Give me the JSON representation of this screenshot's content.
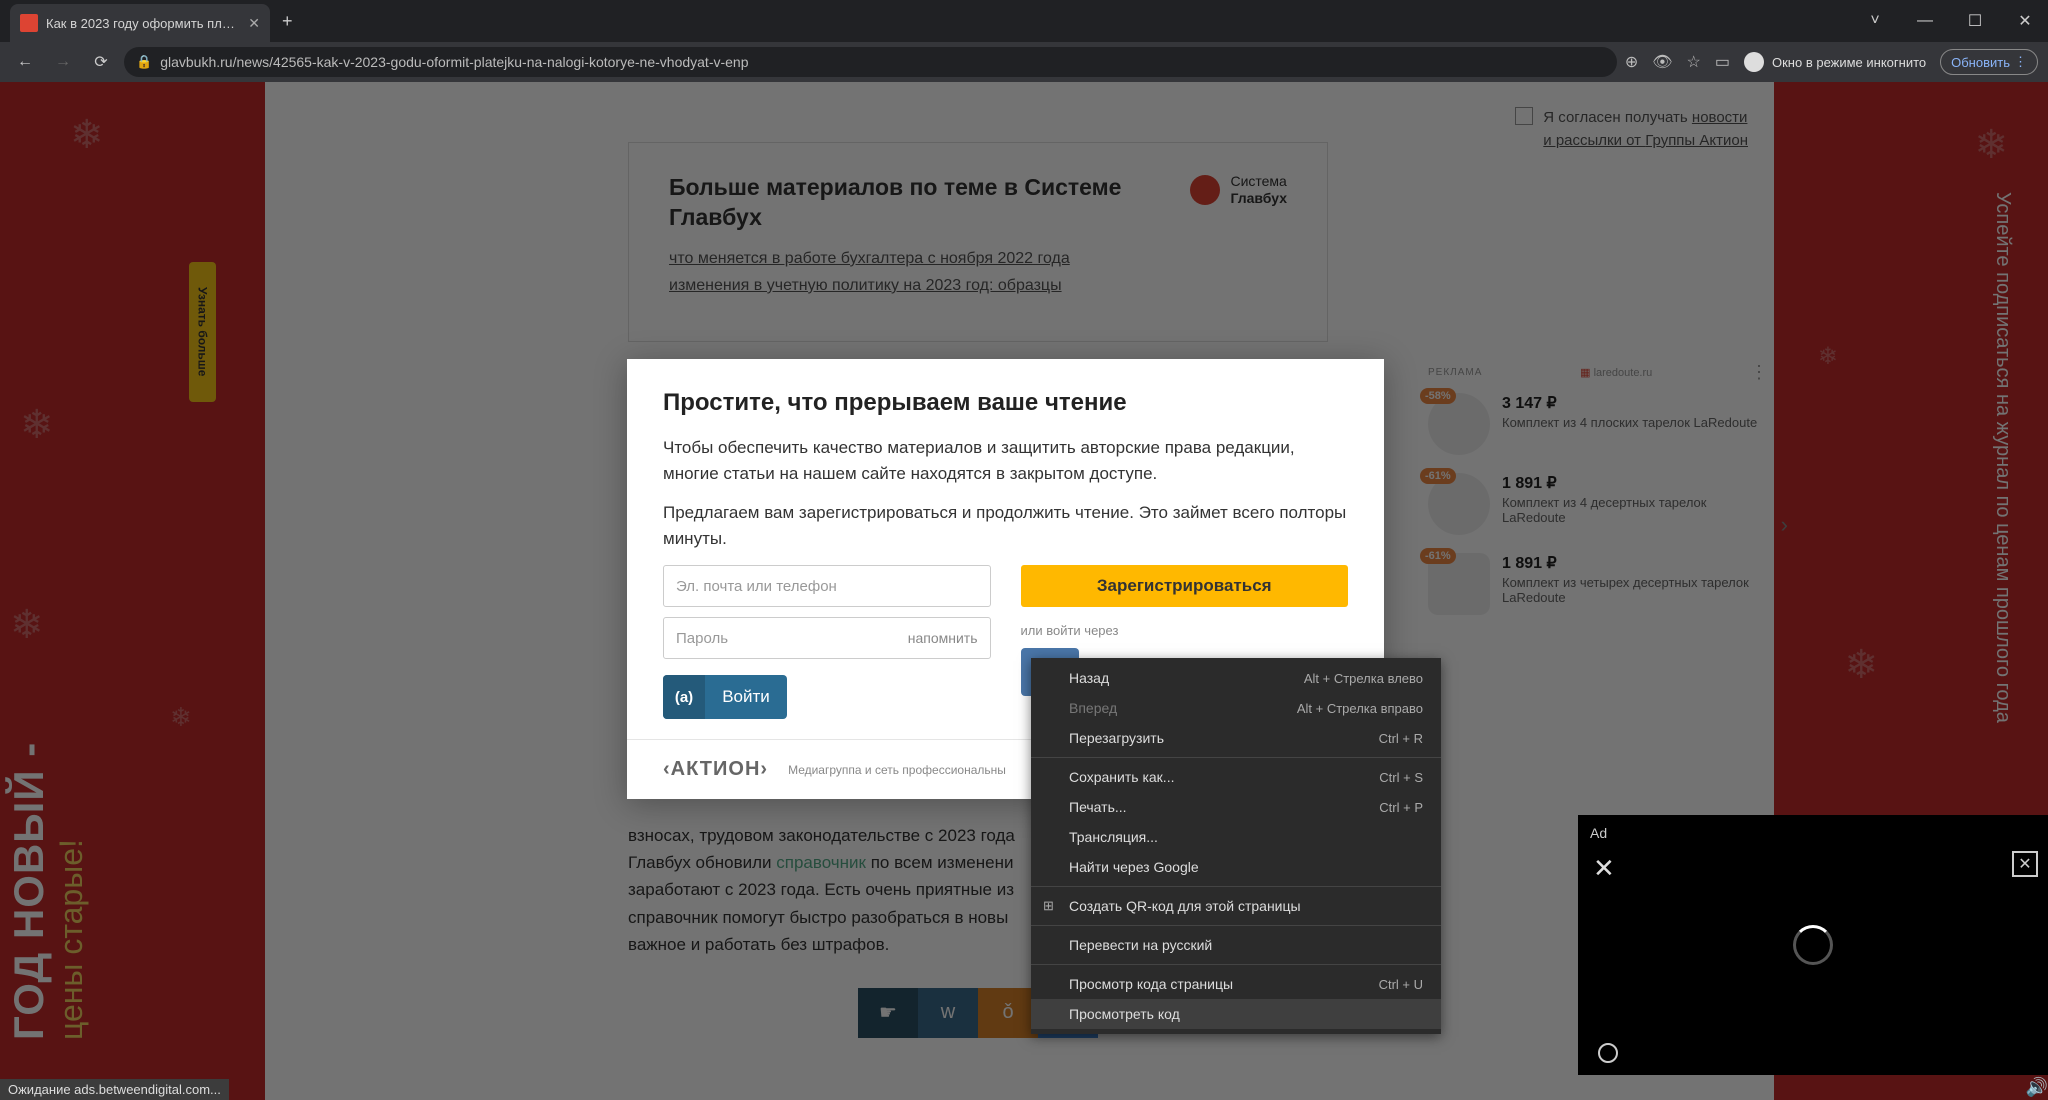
{
  "browser": {
    "tab_title": "Как в 2023 году оформить плат...",
    "url": "glavbukh.ru/news/42565-kak-v-2023-godu-oformit-platejku-na-nalogi-kotorye-ne-vhodyat-v-enp",
    "incognito_label": "Окно в режиме инкогнито",
    "update_button": "Обновить",
    "status": "Ожидание ads.betweendigital.com..."
  },
  "banners": {
    "left_line1": "ГОД НОВЫЙ -",
    "left_line2": "цены старые!",
    "left_sticker": "Узнать больше",
    "right_text": "Успейте подписаться на журнал по ценам прошлого года"
  },
  "consent": {
    "text_before": "Я согласен получать ",
    "link1": "новости",
    "text_mid": " и рассылки от ",
    "link2": "Группы Актион"
  },
  "related": {
    "title": "Больше материалов по теме в Системе Главбух",
    "brand_top": "Система",
    "brand_bottom": "Главбух",
    "link1": "что меняется в работе бухгалтера с ноября 2022 года",
    "link2": "изменения в учетную политику на 2023 год: образцы"
  },
  "article": {
    "text1": "взносах, трудовом законодательстве с 2023 года",
    "text2": "Главбух обновили ",
    "reflink": "справочник",
    "text3": " по всем изменени",
    "text4": "заработают с 2023 года. Есть очень приятные из",
    "text5": "справочник помогут быстро разобраться в новы",
    "text6": "важное и работать без штрафов."
  },
  "modal": {
    "title": "Простите, что прерываем ваше чтение",
    "p1": "Чтобы обеспечить качество материалов и защитить авторские права редакции, многие статьи на нашем сайте находятся в закрытом доступе.",
    "p2": "Предлагаем вам зарегистрироваться и продолжить чтение. Это займет всего полторы минуты.",
    "email_placeholder": "Эл. почта или телефон",
    "password_placeholder": "Пароль",
    "remember": "напомнить",
    "register": "Зарегистрироваться",
    "login_prefix": "(a)",
    "login": "Войти",
    "social_label": "или войти через",
    "vk": "VK",
    "footer_logo": "‹АКТИОН›",
    "footer_text": "Медиагруппа и сеть профессиональны"
  },
  "ads": {
    "header": "laredoute.ru",
    "label": "РЕКЛАМА",
    "items": [
      {
        "discount": "-58%",
        "price": "3 147 ₽",
        "old": "-",
        "desc": "Комплект из 4 плоских тарелок LaRedoute"
      },
      {
        "discount": "-61%",
        "price": "1 891 ₽",
        "old": "-",
        "desc": "Комплект из 4 десертных тарелок LaRedoute"
      },
      {
        "discount": "-61%",
        "price": "1 891 ₽",
        "old": "-",
        "desc": "Комплект из четырех десертных тарелок LaRedoute"
      }
    ]
  },
  "context_menu": {
    "items": [
      {
        "label": "Назад",
        "shortcut": "Alt + Стрелка влево",
        "disabled": false
      },
      {
        "label": "Вперед",
        "shortcut": "Alt + Стрелка вправо",
        "disabled": true
      },
      {
        "label": "Перезагрузить",
        "shortcut": "Ctrl + R",
        "disabled": false
      },
      {
        "sep": true
      },
      {
        "label": "Сохранить как...",
        "shortcut": "Ctrl + S",
        "disabled": false
      },
      {
        "label": "Печать...",
        "shortcut": "Ctrl + P",
        "disabled": false
      },
      {
        "label": "Трансляция...",
        "shortcut": "",
        "disabled": false
      },
      {
        "label": "Найти через Google",
        "shortcut": "",
        "disabled": false
      },
      {
        "sep": true
      },
      {
        "label": "Создать QR-код для этой страницы",
        "shortcut": "",
        "icon": "qr",
        "disabled": false
      },
      {
        "sep": true
      },
      {
        "label": "Перевести на русский",
        "shortcut": "",
        "disabled": false
      },
      {
        "sep": true
      },
      {
        "label": "Просмотр кода страницы",
        "shortcut": "Ctrl + U",
        "disabled": false
      },
      {
        "label": "Просмотреть код",
        "shortcut": "",
        "highlighted": true,
        "disabled": false
      }
    ]
  },
  "ad_popup": {
    "label": "Ad"
  }
}
